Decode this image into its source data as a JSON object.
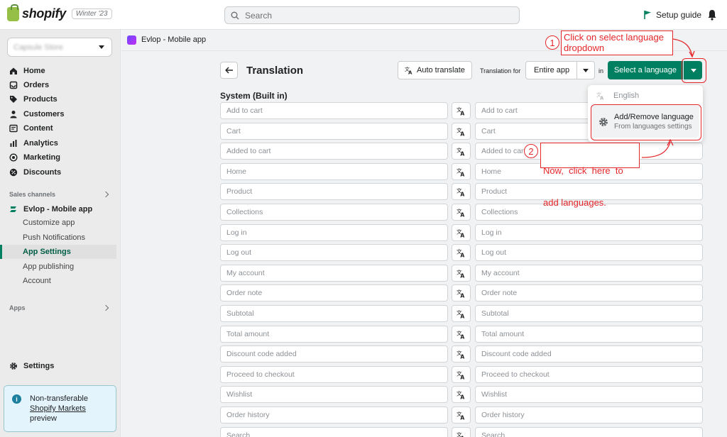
{
  "topbar": {
    "brand": "shopify",
    "badge": "Winter '23",
    "search_placeholder": "Search",
    "setup_guide": "Setup guide"
  },
  "sidebar": {
    "store_name": "Capsule Store",
    "nav": [
      {
        "label": "Home",
        "icon": "home-icon"
      },
      {
        "label": "Orders",
        "icon": "orders-icon"
      },
      {
        "label": "Products",
        "icon": "tag-icon"
      },
      {
        "label": "Customers",
        "icon": "person-icon"
      },
      {
        "label": "Content",
        "icon": "content-icon"
      },
      {
        "label": "Analytics",
        "icon": "bar-chart-icon"
      },
      {
        "label": "Marketing",
        "icon": "target-icon"
      },
      {
        "label": "Discounts",
        "icon": "discount-icon"
      }
    ],
    "sales_channels_label": "Sales channels",
    "channel": "Evlop - Mobile app",
    "channel_sub": [
      "Customize app",
      "Push Notifications",
      "App Settings",
      "App publishing",
      "Account"
    ],
    "apps_label": "Apps",
    "settings": "Settings",
    "info": {
      "line1": "Non-transferable",
      "link": "Shopify Markets",
      "line3": "preview"
    }
  },
  "appbar": {
    "name": "Evlop - Mobile app"
  },
  "page": {
    "title": "Translation",
    "auto_translate": "Auto translate",
    "translation_for": "Translation for",
    "scope": "Entire app",
    "in": "in",
    "select_language": "Select a language",
    "section": "System (Built in)"
  },
  "strings": [
    "Add to cart",
    "Cart",
    "Added to cart",
    "Home",
    "Product",
    "Collections",
    "Log in",
    "Log out",
    "My account",
    "Order note",
    "Subtotal",
    "Total amount",
    "Discount code added",
    "Proceed to checkout",
    "Wishlist",
    "Order history",
    "Search"
  ],
  "popover": {
    "english": "English",
    "add_remove": "Add/Remove language",
    "add_remove_sub": "From languages settings"
  },
  "annotations": {
    "step1_num": "1",
    "step1_line1": "Click on select language",
    "step1_line2": "dropdown",
    "step2_num": "2",
    "step2_line1": "Now,  click  here  to",
    "step2_line2": "add languages."
  },
  "colors": {
    "accent": "#008060",
    "annotation": "#e5262a"
  }
}
